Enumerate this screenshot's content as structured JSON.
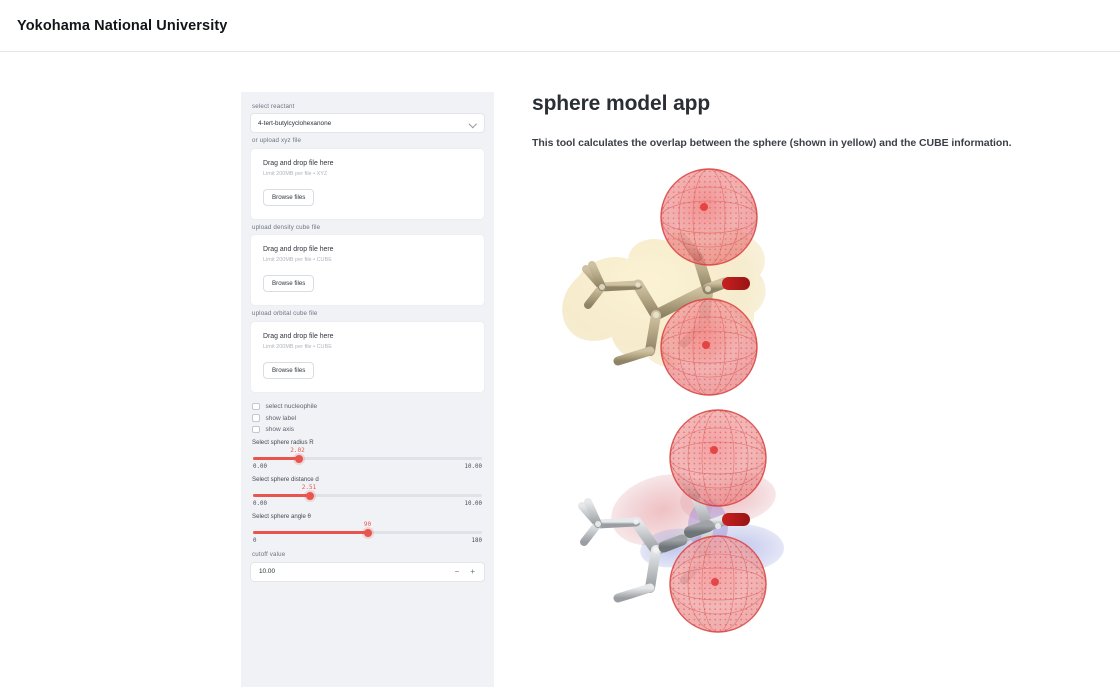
{
  "header": {
    "title": "Yokohama National University"
  },
  "sidebar": {
    "reactant": {
      "label": "select reactant",
      "selected": "4-tert-butylcyclohexanone",
      "chevron_icon": "chevron-down-icon"
    },
    "uploaders": [
      {
        "label": "or upload xyz file",
        "drop_text": "Drag and drop file here",
        "limit_text": "Limit 200MB per file • XYZ",
        "browse_label": "Browse files"
      },
      {
        "label": "upload density cube file",
        "drop_text": "Drag and drop file here",
        "limit_text": "Limit 200MB per file • CUBE",
        "browse_label": "Browse files"
      },
      {
        "label": "upload orbital cube file",
        "drop_text": "Drag and drop file here",
        "limit_text": "Limit 200MB per file • CUBE",
        "browse_label": "Browse files"
      }
    ],
    "checkboxes": [
      {
        "label": "select nucleophile",
        "checked": false
      },
      {
        "label": "show label",
        "checked": false
      },
      {
        "label": "show axis",
        "checked": false
      }
    ],
    "sliders": [
      {
        "label": "Select sphere radius R",
        "value": "2.02",
        "min": "0.00",
        "max": "10.00",
        "percent": 20.2
      },
      {
        "label": "Select sphere distance d",
        "value": "2.51",
        "min": "0.00",
        "max": "10.00",
        "percent": 25.1
      },
      {
        "label": "Select sphere angle θ",
        "value": "90",
        "min": "0",
        "max": "180",
        "percent": 50
      }
    ],
    "cutoff": {
      "label": "cutoff value",
      "value": "10.00",
      "minus_label": "−",
      "plus_label": "+"
    }
  },
  "main": {
    "title": "sphere model app",
    "subtitle": "This tool calculates the overlap between the sphere (shown in yellow) and the CUBE information.",
    "colors": {
      "accent": "#e8554e",
      "sidebar_bg": "#f0f2f6",
      "sphere_mesh": "#e24a4a",
      "sphere_yellow": "#f0e0b0",
      "molecule_tan": "#b8ab8c",
      "molecule_gray": "#c9cbcd",
      "oxygen_red": "#b01c1c",
      "orbital_blue": "#8f97d8"
    },
    "visualizations": [
      {
        "name": "density-cube-view",
        "description": "4-tert-butylcyclohexanone ball-and-stick model in tan with translucent yellow electron-density surface and two red mesh spheres on the carbonyl face"
      },
      {
        "name": "orbital-cube-view",
        "description": "Same molecule rendered in gray/white with red and blue LUMO orbital lobes and two red mesh spheres"
      }
    ]
  }
}
